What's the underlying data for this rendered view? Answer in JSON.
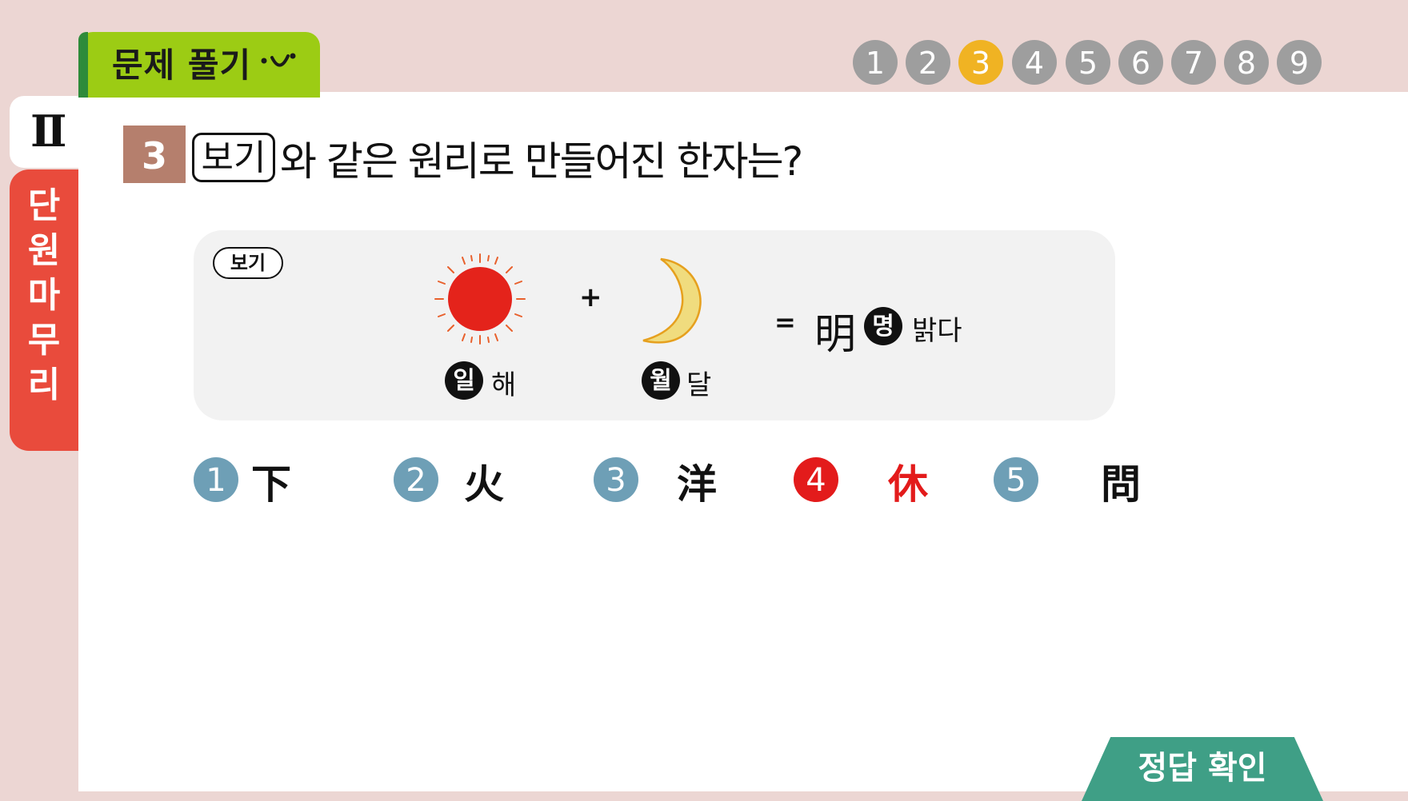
{
  "header": {
    "tab_label": "문제 풀기"
  },
  "side": {
    "roman": "Ⅱ",
    "unit_label": [
      "단",
      "원",
      "마",
      "무",
      "리"
    ]
  },
  "progress": {
    "steps": [
      "1",
      "2",
      "3",
      "4",
      "5",
      "6",
      "7",
      "8",
      "9"
    ],
    "current": "3"
  },
  "question": {
    "number": "3",
    "box_label": "보기",
    "text": "와 같은 원리로 만들어진 한자는?"
  },
  "example": {
    "tag": "보기",
    "sun": {
      "badge": "일",
      "meaning": "해"
    },
    "plus": "+",
    "moon": {
      "badge": "월",
      "meaning": "달"
    },
    "equals": "=",
    "result": {
      "hanja": "明",
      "badge": "명",
      "meaning": "밝다"
    }
  },
  "options": [
    {
      "num": "1",
      "char": "下"
    },
    {
      "num": "2",
      "char": "火"
    },
    {
      "num": "3",
      "char": "洋"
    },
    {
      "num": "4",
      "char": "休"
    },
    {
      "num": "5",
      "char": "問"
    }
  ],
  "selected_option": "4",
  "answer_button": {
    "label": "정답 확인"
  },
  "colors": {
    "active_step": "#f0b323",
    "inactive_step": "#9e9e9e",
    "option_circle": "#6e9fb6",
    "correct": "#e31b1b",
    "answer_button": "#3f9f86",
    "unit_tab": "#e94b3c",
    "header_tab": "#9ccc14"
  }
}
